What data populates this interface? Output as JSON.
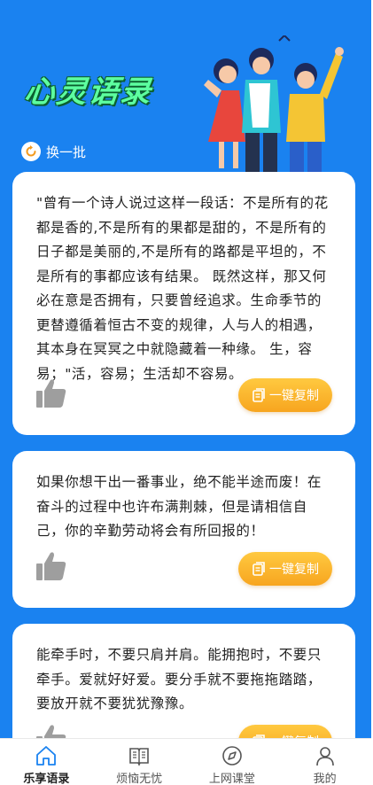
{
  "header": {
    "title": "心灵语录",
    "refresh_label": "换一批"
  },
  "quotes": [
    {
      "text": "\"曾有一个诗人说过这样一段话：不是所有的花都是香的,不是所有的果都是甜的，不是所有的日子都是美丽的,不是所有的路都是平坦的，不是所有的事都应该有结果。 既然这样，那又何必在意是否拥有，只要曾经追求。生命季节的更替遵循着恒古不变的规律，人与人的相遇，其本身在冥冥之中就隐藏着一种缘。 生，容易；\"活，容易；生活却不容易。",
      "copy_label": "一键复制"
    },
    {
      "text": "如果你想干出一番事业，绝不能半途而废！在奋斗的过程中也许布满荆棘，但是请相信自己，你的辛勤劳动将会有所回报的！",
      "copy_label": "一键复制"
    },
    {
      "text": "能牵手时，不要只肩并肩。能拥抱时，不要只牵手。爱就好好爱。要分手就不要拖拖踏踏，要放开就不要犹犹豫豫。",
      "copy_label": "一键复制"
    }
  ],
  "tabs": [
    {
      "label": "乐享语录",
      "icon": "home-icon",
      "active": true
    },
    {
      "label": "烦恼无忧",
      "icon": "book-icon",
      "active": false
    },
    {
      "label": "上网课堂",
      "icon": "compass-icon",
      "active": false
    },
    {
      "label": "我的",
      "icon": "user-icon",
      "active": false
    }
  ],
  "colors": {
    "background": "#1a82f0",
    "title_green": "#5dffa0",
    "button_orange": "#f7a51f",
    "active_tab": "#1a82f0"
  }
}
